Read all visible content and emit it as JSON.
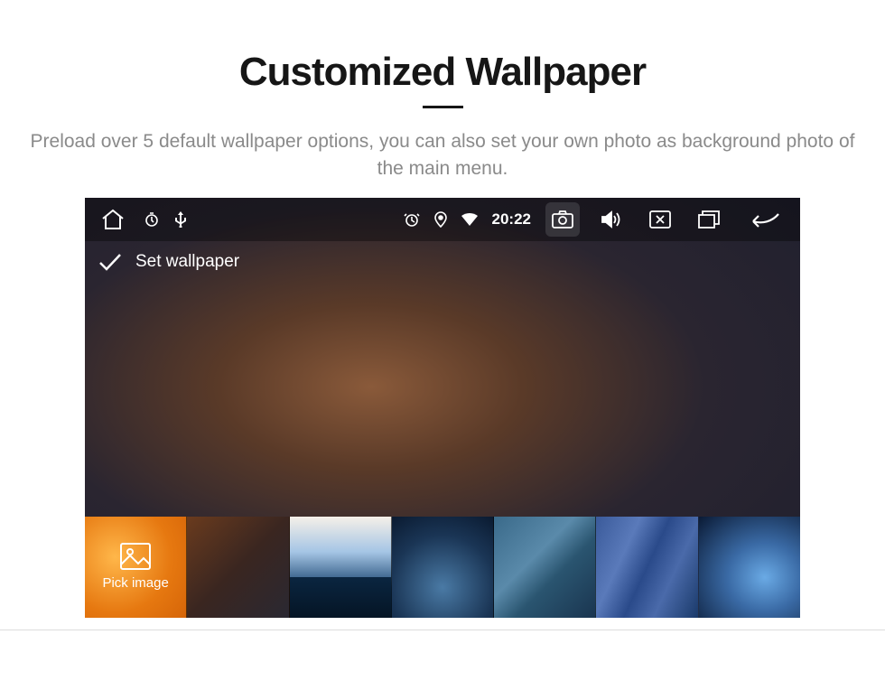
{
  "page": {
    "title": "Customized Wallpaper",
    "subtitle": "Preload over 5 default wallpaper options, you can also set your own photo as background photo of the main menu."
  },
  "screen": {
    "status": {
      "time": "20:22",
      "icons": {
        "home": "home-icon",
        "timer_left": "timer-icon",
        "usb": "usb-icon",
        "alarm": "alarm-icon",
        "location": "location-icon",
        "wifi": "wifi-icon",
        "camera": "camera-icon",
        "speaker": "speaker-icon",
        "close_window": "window-x-icon",
        "windows": "windows-icon",
        "back": "back-icon"
      }
    },
    "action": {
      "confirm": "Set wallpaper"
    },
    "thumbnails": {
      "pick_label": "Pick image"
    }
  }
}
